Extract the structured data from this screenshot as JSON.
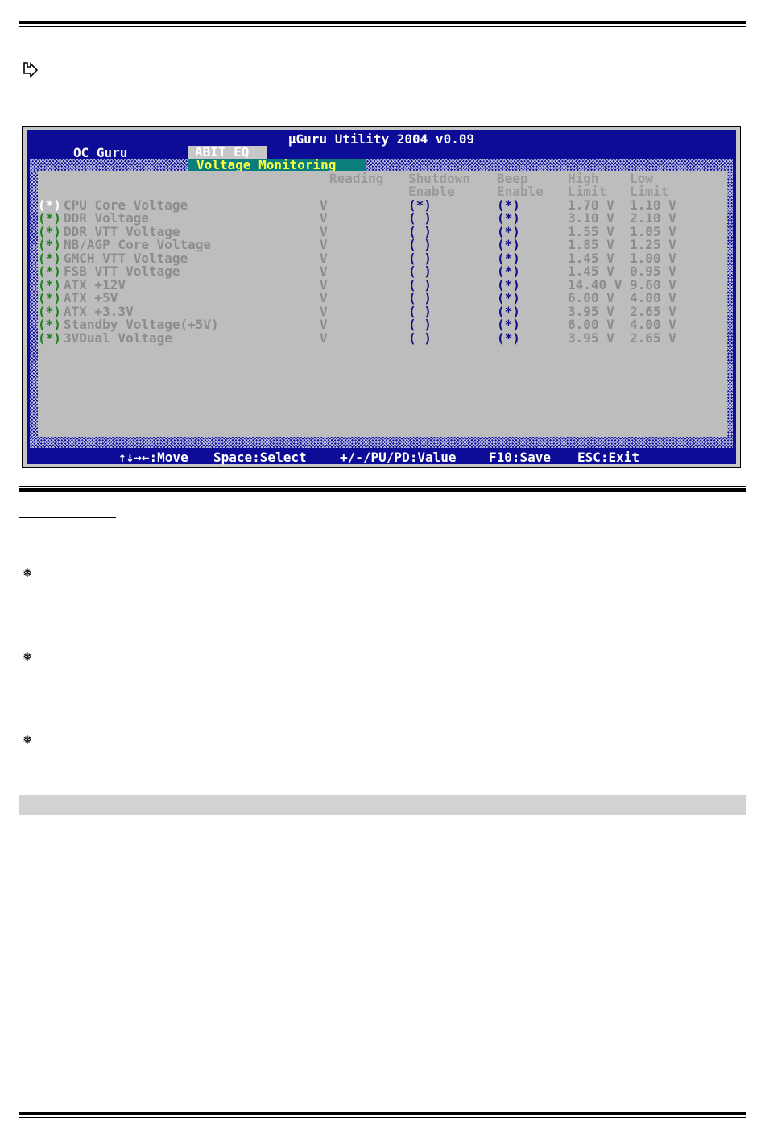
{
  "bios": {
    "title": "µGuru Utility 2004 v0.09",
    "menu": {
      "oc_guru": "OC Guru",
      "abit_eq": "ABIT EQ"
    },
    "active_tab": "Voltage Monitoring",
    "columns": {
      "reading": "Reading",
      "shutdown_1": "Shutdown",
      "shutdown_2": "Enable",
      "beep_1": "Beep",
      "beep_2": "Enable",
      "high_1": "High",
      "high_2": "Limit",
      "low_1": "Low",
      "low_2": "Limit"
    },
    "rows": [
      {
        "select": "(*)",
        "label": "CPU Core Voltage",
        "reading": "V",
        "shutdown": "(*)",
        "beep": "(*)",
        "high": "1.70 V",
        "low": "1.10 V"
      },
      {
        "select": "(*)",
        "label": "DDR Voltage",
        "reading": "V",
        "shutdown": "( )",
        "beep": "(*)",
        "high": "3.10 V",
        "low": "2.10 V"
      },
      {
        "select": "(*)",
        "label": "DDR VTT Voltage",
        "reading": "V",
        "shutdown": "( )",
        "beep": "(*)",
        "high": "1.55 V",
        "low": "1.05 V"
      },
      {
        "select": "(*)",
        "label": "NB/AGP Core Voltage",
        "reading": "V",
        "shutdown": "( )",
        "beep": "(*)",
        "high": "1.85 V",
        "low": "1.25 V"
      },
      {
        "select": "(*)",
        "label": "GMCH VTT Voltage",
        "reading": "V",
        "shutdown": "( )",
        "beep": "(*)",
        "high": "1.45 V",
        "low": "1.00 V"
      },
      {
        "select": "(*)",
        "label": "FSB VTT Voltage",
        "reading": "V",
        "shutdown": "( )",
        "beep": "(*)",
        "high": "1.45 V",
        "low": "0.95 V"
      },
      {
        "select": "(*)",
        "label": "ATX +12V",
        "reading": "V",
        "shutdown": "( )",
        "beep": "(*)",
        "high": "14.40 V",
        "low": "9.60 V"
      },
      {
        "select": "(*)",
        "label": "ATX +5V",
        "reading": "V",
        "shutdown": "( )",
        "beep": "(*)",
        "high": "6.00 V",
        "low": "4.00 V"
      },
      {
        "select": "(*)",
        "label": "ATX +3.3V",
        "reading": "V",
        "shutdown": "( )",
        "beep": "(*)",
        "high": "3.95 V",
        "low": "2.65 V"
      },
      {
        "select": "(*)",
        "label": "Standby Voltage(+5V)",
        "reading": "V",
        "shutdown": "( )",
        "beep": "(*)",
        "high": "6.00 V",
        "low": "4.00 V"
      },
      {
        "select": "(*)",
        "label": "3VDual Voltage",
        "reading": "V",
        "shutdown": "( )",
        "beep": "(*)",
        "high": "3.95 V",
        "low": "2.65 V"
      }
    ],
    "footer": {
      "move": "↑↓→←:Move",
      "select": "Space:Select",
      "value": "+/-/PU/PD:Value",
      "save": "F10:Save",
      "exit": "ESC:Exit"
    }
  },
  "icons": {
    "pointer": "arrow-pointer-icon",
    "bullet": "snowflake-bullet-icon"
  }
}
